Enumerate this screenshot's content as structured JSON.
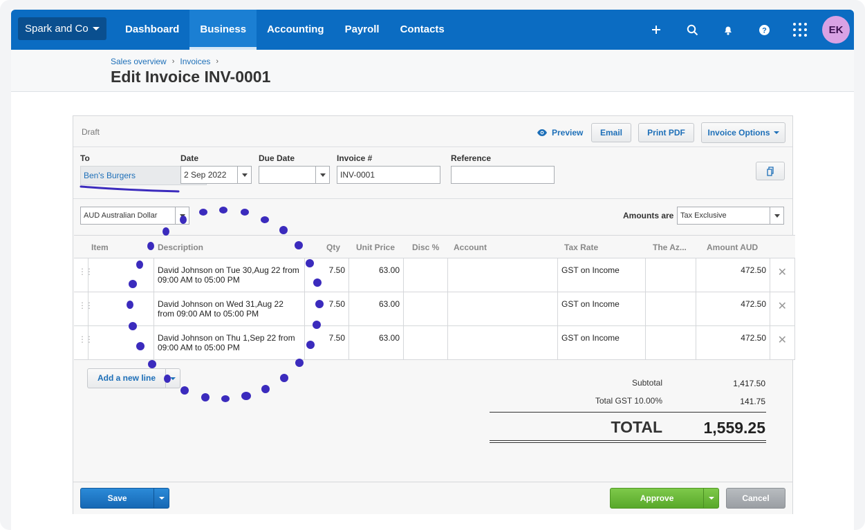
{
  "org": {
    "name": "Spark and Co"
  },
  "nav": {
    "items": [
      "Dashboard",
      "Business",
      "Accounting",
      "Payroll",
      "Contacts"
    ],
    "active": "Business"
  },
  "user": {
    "initials": "EK"
  },
  "breadcrumb": [
    "Sales overview",
    "Invoices"
  ],
  "page_title": "Edit Invoice INV-0001",
  "invoice": {
    "status": "Draft",
    "actions": {
      "preview": "Preview",
      "email": "Email",
      "print_pdf": "Print PDF",
      "options": "Invoice Options"
    },
    "labels": {
      "to": "To",
      "date": "Date",
      "due_date": "Due Date",
      "invoice_no": "Invoice #",
      "reference": "Reference",
      "amounts_are": "Amounts are"
    },
    "to": "Ben's Burgers",
    "date": "2 Sep 2022",
    "due_date": "",
    "invoice_no": "INV-0001",
    "reference": "",
    "currency": "AUD Australian Dollar",
    "amounts_are": "Tax Exclusive"
  },
  "table": {
    "headers": {
      "item": "Item",
      "description": "Description",
      "qty": "Qty",
      "unit_price": "Unit Price",
      "disc": "Disc %",
      "account": "Account",
      "tax_rate": "Tax Rate",
      "the_az": "The Az...",
      "amount": "Amount AUD"
    },
    "rows": [
      {
        "item": "",
        "description": "David Johnson on Tue 30,Aug 22 from 09:00 AM to 05:00 PM",
        "qty": "7.50",
        "unit_price": "63.00",
        "disc": "",
        "account": "",
        "tax_rate": "GST on Income",
        "the_az": "",
        "amount": "472.50"
      },
      {
        "item": "",
        "description": "David Johnson on Wed 31,Aug 22 from 09:00 AM to 05:00 PM",
        "qty": "7.50",
        "unit_price": "63.00",
        "disc": "",
        "account": "",
        "tax_rate": "GST on Income",
        "the_az": "",
        "amount": "472.50"
      },
      {
        "item": "",
        "description": "David Johnson on Thu 1,Sep 22 from 09:00 AM to 05:00 PM",
        "qty": "7.50",
        "unit_price": "63.00",
        "disc": "",
        "account": "",
        "tax_rate": "GST on Income",
        "the_az": "",
        "amount": "472.50"
      }
    ],
    "add_line": "Add a new line"
  },
  "totals": {
    "subtotal_label": "Subtotal",
    "subtotal": "1,417.50",
    "gst_label": "Total GST 10.00%",
    "gst": "141.75",
    "total_label": "TOTAL",
    "total": "1,559.25"
  },
  "footer": {
    "save": "Save",
    "approve": "Approve",
    "cancel": "Cancel"
  },
  "colors": {
    "nav_bg": "#0b6cc2",
    "link": "#1d6fb8",
    "save": "#1668b4",
    "approve": "#58a82a",
    "annotation": "#3b2bbd"
  },
  "icons": {
    "add": "plus-icon",
    "search": "search-icon",
    "notifications": "bell-icon",
    "help": "help-icon",
    "apps": "grid-icon",
    "preview": "eye-icon",
    "copy": "copy-icon",
    "delete": "close-icon"
  }
}
